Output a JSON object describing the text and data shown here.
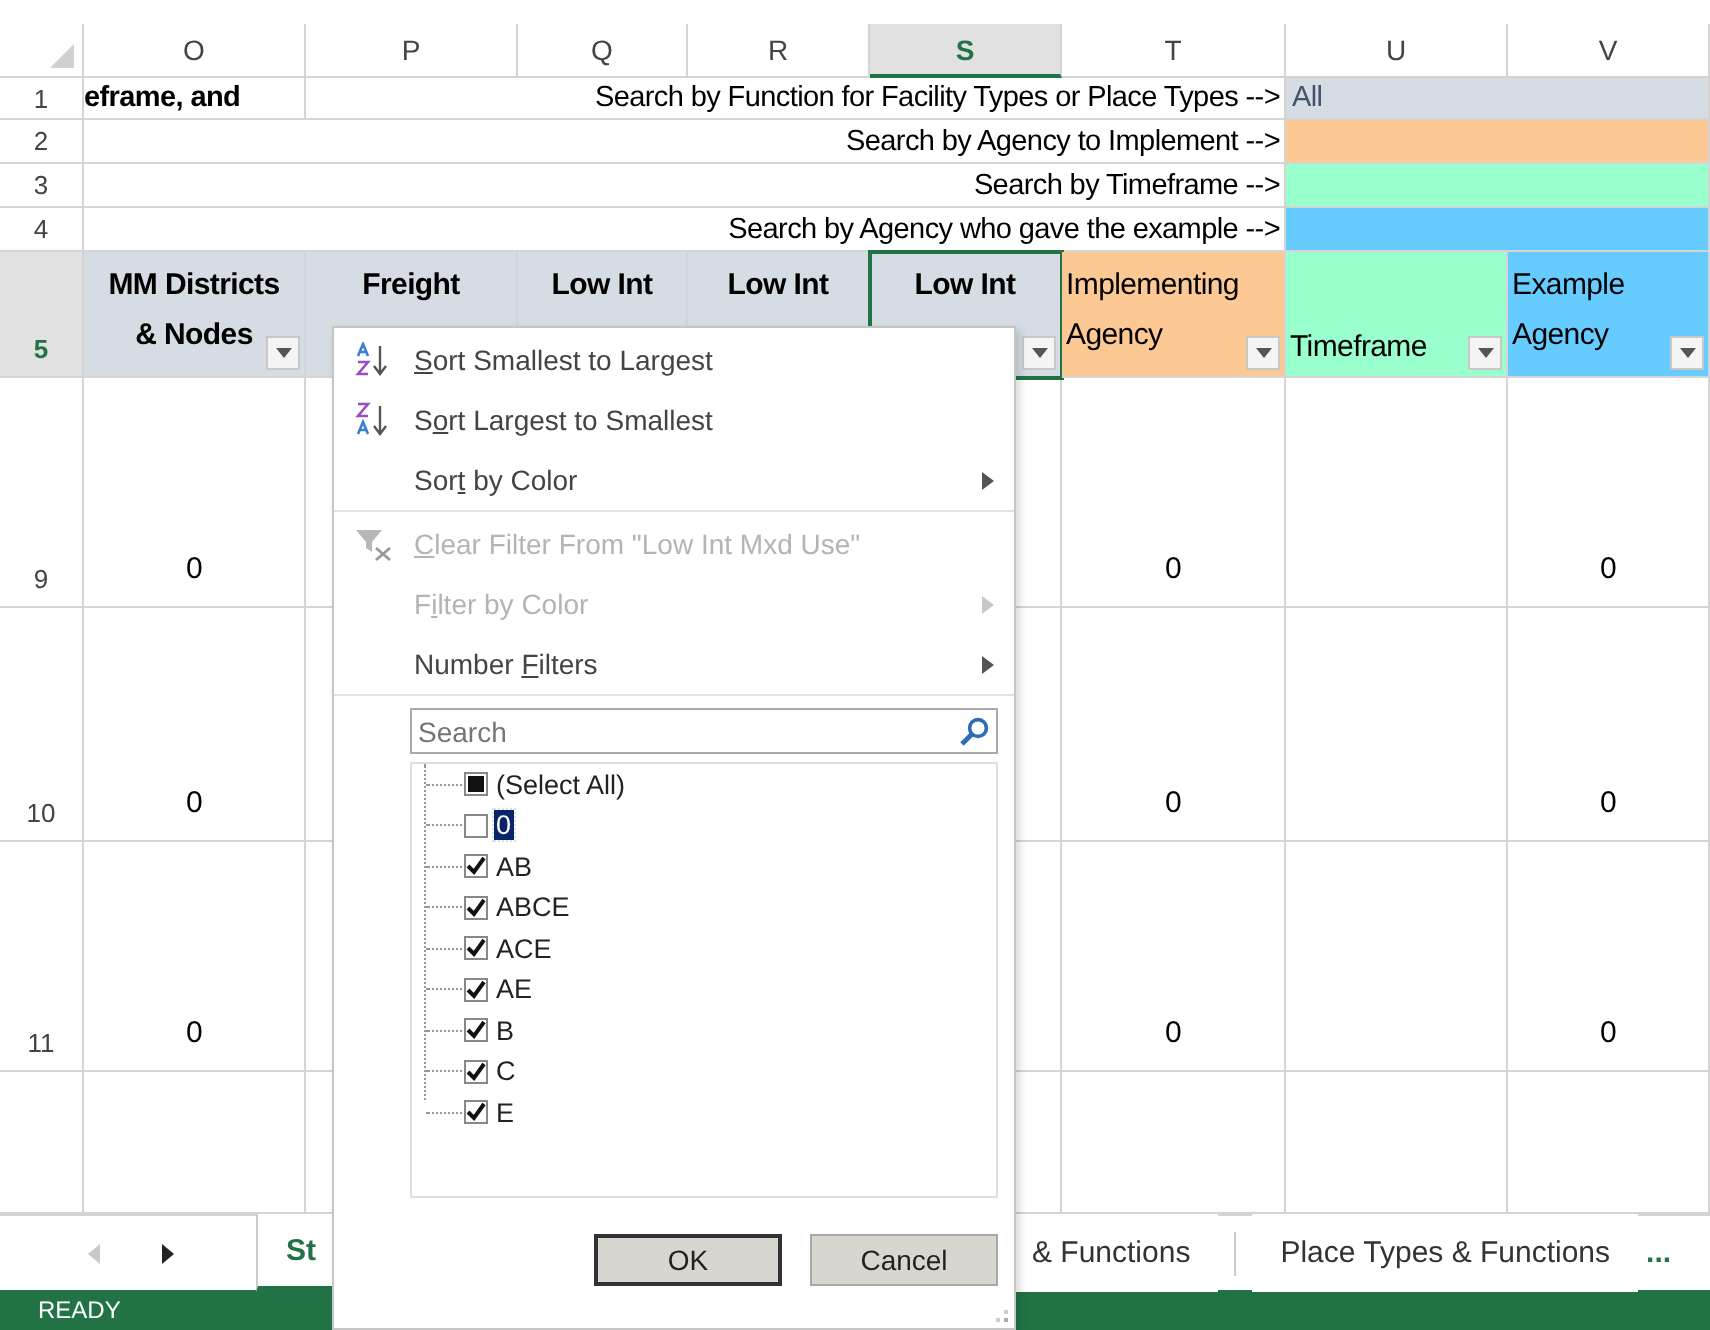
{
  "columns": [
    {
      "label": "O",
      "selected": false
    },
    {
      "label": "P",
      "selected": false
    },
    {
      "label": "Q",
      "selected": false
    },
    {
      "label": "R",
      "selected": false
    },
    {
      "label": "S",
      "selected": true
    },
    {
      "label": "T",
      "selected": false
    },
    {
      "label": "U",
      "selected": false
    },
    {
      "label": "V",
      "selected": false
    }
  ],
  "search_rows": [
    {
      "row": "1",
      "lead": "eframe, and",
      "label": "Search by Function for Facility Types or Place Types -->",
      "value": "All",
      "color": "#d6dce4"
    },
    {
      "row": "2",
      "label": "Search by Agency to Implement -->",
      "color": "#fcc995"
    },
    {
      "row": "3",
      "label": "Search by Timeframe -->",
      "color": "#99ffcc"
    },
    {
      "row": "4",
      "label": "Search by Agency who gave the example -->",
      "color": "#66ccff"
    }
  ],
  "header_row": {
    "row": "5",
    "selected": true,
    "cells": [
      {
        "lines": [
          "MM Districts",
          "& Nodes"
        ],
        "color": "#d6dce4",
        "bold": true,
        "selected": false,
        "filter": true
      },
      {
        "lines": [
          "Freight"
        ],
        "color": "#d6dce4",
        "bold": true,
        "selected": false,
        "filter": false
      },
      {
        "lines": [
          "Low Int"
        ],
        "color": "#d6dce4",
        "bold": true,
        "selected": false,
        "filter": false
      },
      {
        "lines": [
          "Low Int"
        ],
        "color": "#d6dce4",
        "bold": true,
        "selected": false,
        "filter": false
      },
      {
        "lines": [
          "Low Int"
        ],
        "color": "#d6dce4",
        "bold": true,
        "selected": true,
        "filter": true
      },
      {
        "lines": [
          "Implementing",
          "Agency"
        ],
        "color": "#fcc995",
        "bold": false,
        "selected": false,
        "filter": true
      },
      {
        "lines": [
          "Timeframe"
        ],
        "color": "#99ffcc",
        "bold": false,
        "selected": false,
        "filter": true
      },
      {
        "lines": [
          "Example",
          "Agency"
        ],
        "color": "#66ccff",
        "bold": false,
        "selected": false,
        "filter": true
      }
    ]
  },
  "data_rows": [
    {
      "row": "9",
      "cells": [
        "0",
        null,
        null,
        null,
        null,
        "0",
        null,
        "0"
      ]
    },
    {
      "row": "10",
      "cells": [
        "0",
        null,
        null,
        null,
        null,
        "0",
        null,
        "0"
      ]
    },
    {
      "row": "11",
      "cells": [
        "0",
        null,
        null,
        null,
        null,
        "0",
        null,
        "0"
      ]
    }
  ],
  "sheet_tabs": [
    {
      "label": "St",
      "selected": true
    },
    {
      "label": "& Functions",
      "selected": false
    },
    {
      "label": "Place Types & Functions",
      "selected": false
    }
  ],
  "more_tabs": "...",
  "status": "READY",
  "filter_menu": {
    "items": [
      {
        "kind": "sort-asc",
        "label": {
          "key": "S",
          "post": "ort Smallest to Largest"
        },
        "disabled": false,
        "submenu": false,
        "separator_after": false
      },
      {
        "kind": "sort-desc",
        "label": {
          "pre": "S",
          "key": "o",
          "post": "rt Largest to Smallest"
        },
        "disabled": false,
        "submenu": false,
        "separator_after": false
      },
      {
        "kind": "plain",
        "label": {
          "pre": "Sor",
          "key": "t",
          "post": " by Color"
        },
        "disabled": false,
        "submenu": true,
        "separator_after": true
      },
      {
        "kind": "clear",
        "label": {
          "key": "C",
          "post": "lear Filter From \"Low Int Mxd Use\""
        },
        "disabled": true,
        "submenu": false,
        "separator_after": false
      },
      {
        "kind": "plain",
        "label": {
          "pre": "F",
          "key": "i",
          "post": "lter by Color"
        },
        "disabled": true,
        "submenu": true,
        "separator_after": false
      },
      {
        "kind": "plain",
        "label": {
          "pre": "Number ",
          "key": "F",
          "post": "ilters"
        },
        "disabled": false,
        "submenu": true,
        "separator_after": true
      }
    ],
    "search": {
      "placeholder": "Search"
    },
    "values": [
      {
        "label": "(Select All)",
        "checked": true,
        "indeterminate": true,
        "selected": false
      },
      {
        "label": "0",
        "checked": false,
        "selected": true
      },
      {
        "label": "AB",
        "checked": true,
        "selected": false
      },
      {
        "label": "ABCE",
        "checked": true,
        "selected": false
      },
      {
        "label": "ACE",
        "checked": true,
        "selected": false
      },
      {
        "label": "AE",
        "checked": true,
        "selected": false
      },
      {
        "label": "B",
        "checked": true,
        "selected": false
      },
      {
        "label": "C",
        "checked": true,
        "selected": false
      },
      {
        "label": "E",
        "checked": true,
        "selected": false
      }
    ],
    "buttons": [
      {
        "label": "OK",
        "default": true
      },
      {
        "label": "Cancel",
        "default": false
      }
    ]
  }
}
